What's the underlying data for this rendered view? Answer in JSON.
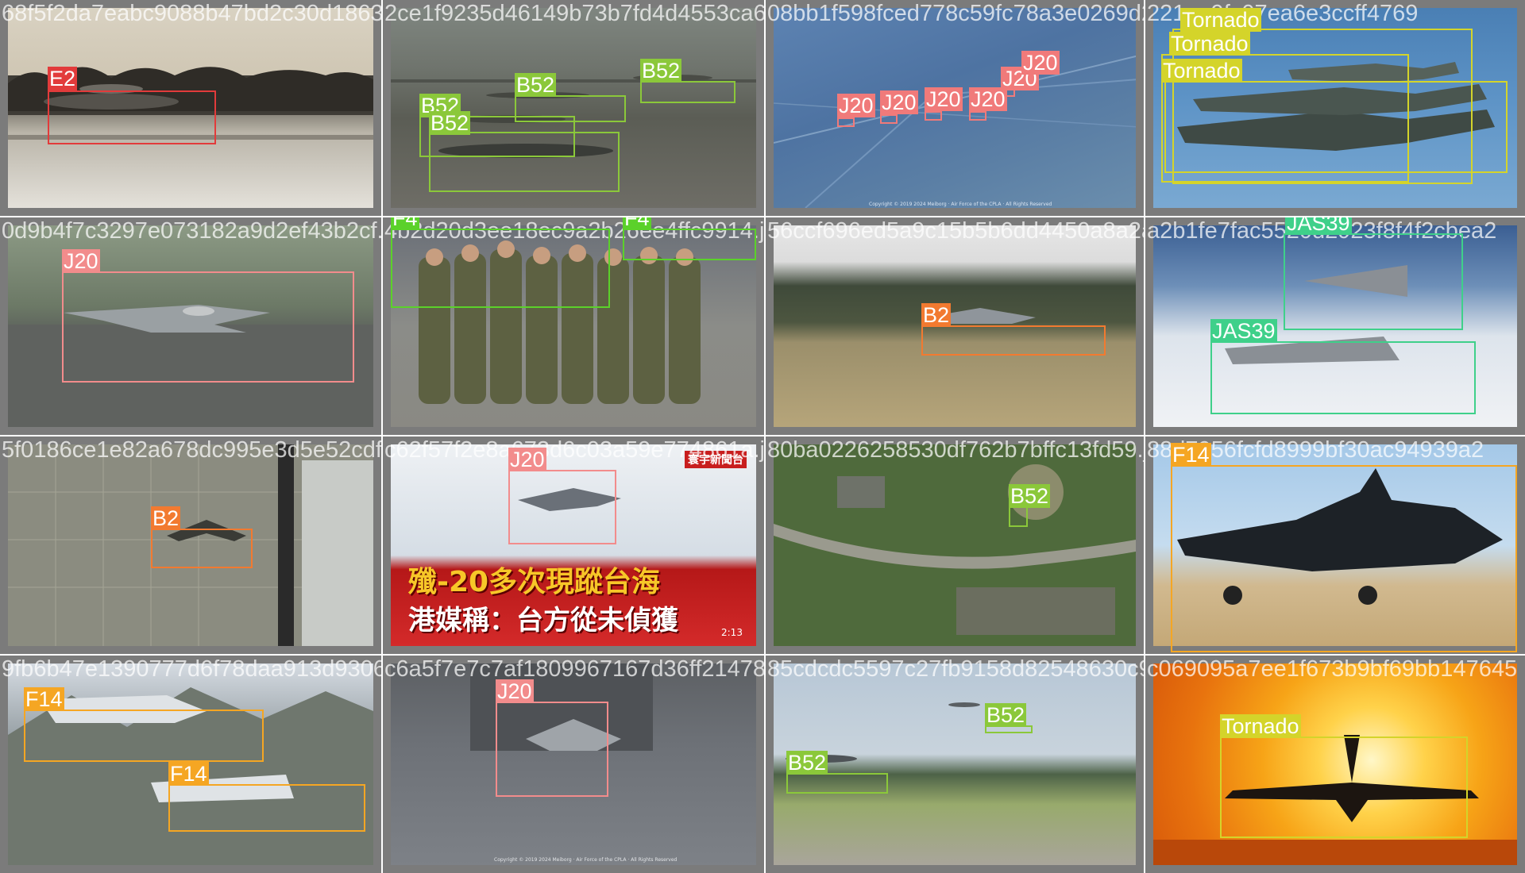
{
  "grid": {
    "tiles": [
      {
        "filename": "68f5f2da7eabc9088b47bd2c30d1863e.jpg",
        "boxes": [
          {
            "label": "E2",
            "color": "#e23b3b"
          }
        ]
      },
      {
        "filename": "2ce1f9235d46149b73b7fd4d4553ca66b.jpg",
        "boxes": [
          {
            "label": "B52",
            "color": "#8bc83a"
          },
          {
            "label": "B52",
            "color": "#8bc83a"
          },
          {
            "label": "B52",
            "color": "#8bc83a"
          },
          {
            "label": "B52",
            "color": "#8bc83a"
          }
        ]
      },
      {
        "filename": "08bb1f598fced778c59fc78a3e0269d221",
        "caption": "Copyright © 2019 2024 Meiborg · Air Force of the CPLA · All Rights Reserved",
        "boxes": [
          {
            "label": "J20",
            "color": "#f07a7a"
          },
          {
            "label": "J20",
            "color": "#f07a7a"
          },
          {
            "label": "J20",
            "color": "#f07a7a"
          },
          {
            "label": "J20",
            "color": "#f07a7a"
          },
          {
            "label": "J20",
            "color": "#f07a7a"
          },
          {
            "label": "J20",
            "color": "#f07a7a"
          }
        ]
      },
      {
        "filename": "221ae9fc07ea6e3ccff4769",
        "boxes": [
          {
            "label": "Tornado",
            "color": "#d4d42a"
          },
          {
            "label": "Tornado",
            "color": "#d4d42a"
          },
          {
            "label": "Tornado",
            "color": "#d4d42a"
          }
        ]
      },
      {
        "filename": "0d9b4f7c3297e073182a9d2ef43b2cf.jpg",
        "boxes": [
          {
            "label": "J20",
            "color": "#f28c8c"
          }
        ]
      },
      {
        "filename": "4b2d20d3ee18ec9a2b26ee4ffc9914.jpg",
        "boxes": [
          {
            "label": "F4",
            "color": "#5bd12a"
          },
          {
            "label": "F4",
            "color": "#5bd12a"
          }
        ]
      },
      {
        "filename": "56ccf696ed5a9c15b5b6dd4450a8a2ab.jpg",
        "boxes": [
          {
            "label": "B2",
            "color": "#f27a30"
          }
        ]
      },
      {
        "filename": "a2b1fe7fac5520d2923f8f4f2cbea2",
        "boxes": [
          {
            "label": "JAS39",
            "color": "#3fd08a"
          },
          {
            "label": "JAS39",
            "color": "#3fd08a"
          }
        ]
      },
      {
        "filename": "5f0186ce1e82a678dc995e3d5e52cdf.jpg",
        "boxes": [
          {
            "label": "B2",
            "color": "#f27a30"
          }
        ]
      },
      {
        "filename": "c62f57f2e8a673d6c03a59e774861a.jpg",
        "headline1": "殲-20多次現蹤台海",
        "headline2": "港媒稱：台方從未偵獲",
        "channel": "寰宇新聞台",
        "timestamp": "2:13",
        "boxes": [
          {
            "label": "J20",
            "color": "#f28c8c"
          }
        ]
      },
      {
        "filename": "80ba0226258530df762b7bffc13fd59.jpg",
        "boxes": [
          {
            "label": "B52",
            "color": "#8bc83a"
          }
        ]
      },
      {
        "filename": "88d7956fcfd8999bf30ac94939a2",
        "boxes": [
          {
            "label": "F14",
            "color": "#f5a623"
          }
        ]
      },
      {
        "filename": "9fb6b47e1390777d6f78daa913d9306.jpg",
        "boxes": [
          {
            "label": "F14",
            "color": "#f5a623"
          },
          {
            "label": "F14",
            "color": "#f5a623"
          }
        ]
      },
      {
        "filename": "c6a5f7e7c7af1809967167d36ff21478.jpg",
        "caption": "Copyright © 2019 2024 Meiborg · Air Force of the CPLA · All Rights Reserved",
        "boxes": [
          {
            "label": "J20",
            "color": "#f28c8c"
          }
        ]
      },
      {
        "filename": "85cdcdc5597c27fb9158d82548630c9.jpg",
        "boxes": [
          {
            "label": "B52",
            "color": "#8bc83a"
          },
          {
            "label": "B52",
            "color": "#8bc83a"
          }
        ]
      },
      {
        "filename": "c069095a7ee1f673b9bf69bb147645",
        "boxes": [
          {
            "label": "Tornado",
            "color": "#d4d42a"
          }
        ]
      }
    ]
  }
}
